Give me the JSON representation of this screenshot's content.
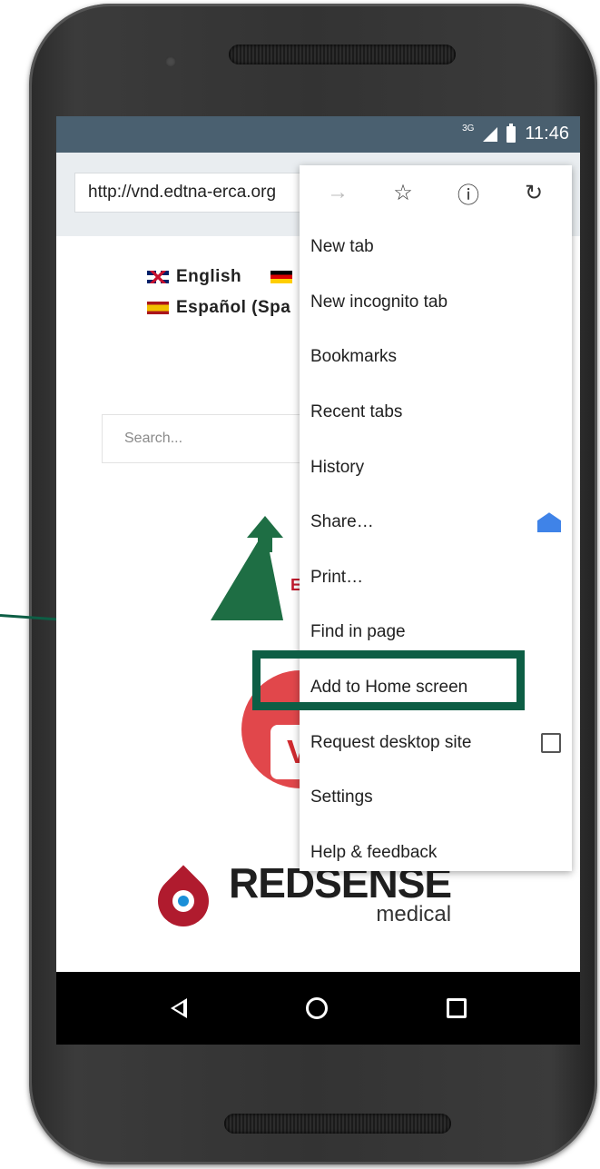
{
  "status_bar": {
    "network": "3G",
    "time": "11:46"
  },
  "browser": {
    "url": "http://vnd.edtna-erca.org",
    "menu": {
      "items": [
        "New tab",
        "New incognito tab",
        "Bookmarks",
        "Recent tabs",
        "History",
        "Share…",
        "Print…",
        "Find in page",
        "Add to Home screen",
        "Request desktop site",
        "Settings",
        "Help & feedback"
      ]
    }
  },
  "page": {
    "languages": {
      "english": "English",
      "spanish": "Español (Spa"
    },
    "search_placeholder": "Search...",
    "sponsor": {
      "brand": "REDSENSE",
      "sub": "medical"
    },
    "logo_letter": "E",
    "badge_letter": "V"
  },
  "colors": {
    "highlight": "#0d5e45",
    "status_bar": "#4a6070",
    "toolbar": "#e9edf0"
  }
}
